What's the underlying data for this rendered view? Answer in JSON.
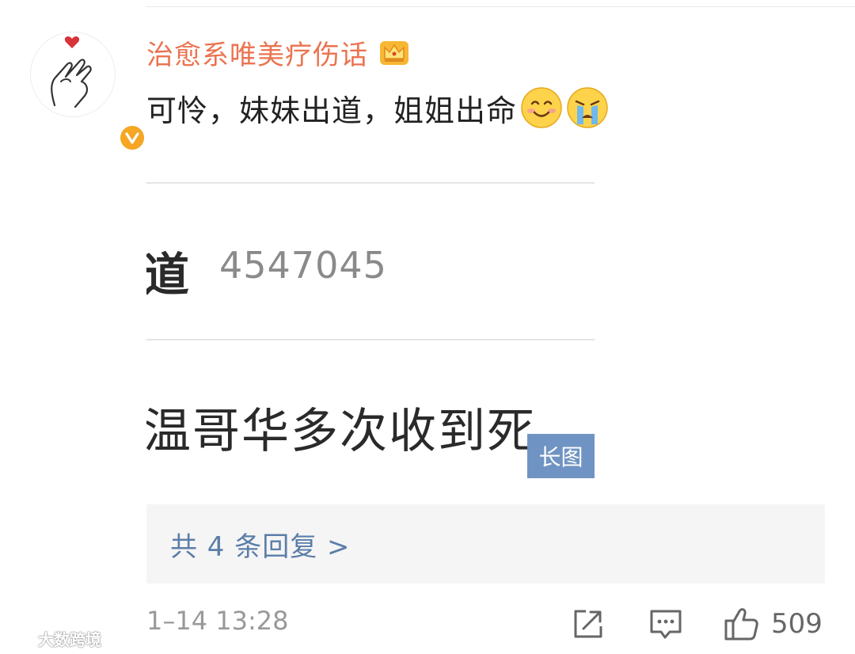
{
  "comment": {
    "username": "治愈系唯美疗伤话",
    "text": "可怜，妹妹出道，姐姐出命",
    "emojis": [
      "smile-emoji",
      "crying-emoji"
    ],
    "username_color": "#eb7350",
    "badge_icon": "crown-icon",
    "verified_icon": "verified-badge-icon"
  },
  "attached_image": {
    "line1_text": "道",
    "line1_number": "4547045",
    "line2_text": "温哥华多次收到死",
    "badge_label": "长图"
  },
  "replies": {
    "label": "共 4 条回复 >"
  },
  "footer": {
    "timestamp": "1–14 13:28",
    "like_count": "509"
  },
  "watermark": {
    "text": "大数跨境"
  }
}
